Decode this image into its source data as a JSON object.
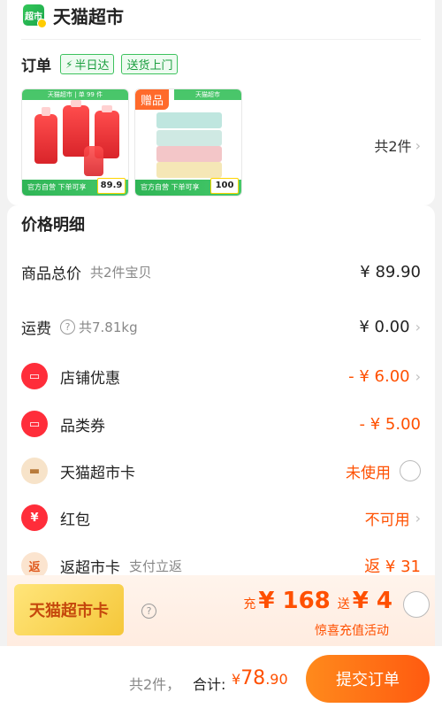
{
  "store": {
    "logo_text": "超市",
    "name": "天猫超市"
  },
  "order": {
    "label": "订单",
    "tags": [
      "半日达",
      "送货上门"
    ],
    "count_text": "共2件",
    "products": [
      {
        "top_text": "天猫超市 | 单 99 件",
        "bottom_text": "官方自营 下单可享",
        "price": "89.9"
      },
      {
        "gift_label": "赠品",
        "top_text": "天猫超市",
        "bottom_text": "官方自营 下单可享",
        "price": "100"
      }
    ]
  },
  "price_detail": {
    "title": "价格明细",
    "rows": [
      {
        "label": "商品总价",
        "sub": "共2件宝贝",
        "value": "¥ 89.90"
      },
      {
        "label": "运费",
        "sub": "共7.81kg",
        "value": "¥ 0.00"
      },
      {
        "label": "店铺优惠",
        "value": "- ¥ 6.00",
        "icon": "coupon-icon"
      },
      {
        "label": "品类券",
        "value": "- ¥ 5.00",
        "icon": "coupon-icon"
      },
      {
        "label": "天猫超市卡",
        "value": "未使用",
        "icon": "card-icon"
      },
      {
        "label": "红包",
        "value": "不可用",
        "icon": "red-envelope-icon"
      },
      {
        "label": "返超市卡",
        "sub": "支付立返",
        "value": "返 ¥ 31",
        "icon": "rebate-icon",
        "icon_text": "返"
      }
    ]
  },
  "promo": {
    "card_title": "天猫超市卡",
    "charge_prefix": "充",
    "charge_amount": "¥ 168",
    "gift_prefix": "送",
    "gift_amount": "¥ 4",
    "subtitle": "惊喜充值活动"
  },
  "bottom": {
    "count": "共2件，",
    "total_label": "合计:",
    "yen": "¥",
    "total_int": "78",
    "total_dec": ".90",
    "submit_label": "提交订单"
  },
  "colors": {
    "accent": "#ff5000",
    "green": "#1a9e3e"
  }
}
